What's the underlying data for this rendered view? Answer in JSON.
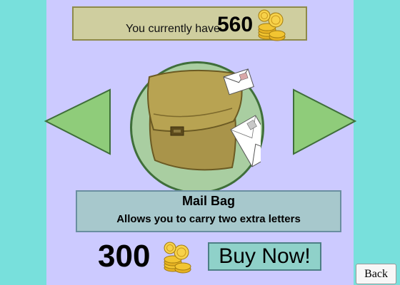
{
  "balance": {
    "label": "You currently have",
    "amount": "560"
  },
  "item": {
    "name": "Mail Bag",
    "description": "Allows you to carry two extra letters",
    "price": "300"
  },
  "buttons": {
    "buy_label": "Buy Now!",
    "back_label": "Back"
  },
  "icons": {
    "prev": "left-arrow-icon",
    "next": "right-arrow-icon",
    "coins": "gold-coins-icon",
    "item": "mail-bag-icon"
  },
  "colors": {
    "background": "#78e0dc",
    "panel": "#cccaff",
    "balance_box": "#cfce9f",
    "arrow_fill": "#8fcc7a",
    "circle": "#a9cea1",
    "desc_box": "#a7c8cc",
    "buy_button": "#8fd1c9",
    "coin": "#f2c531"
  }
}
